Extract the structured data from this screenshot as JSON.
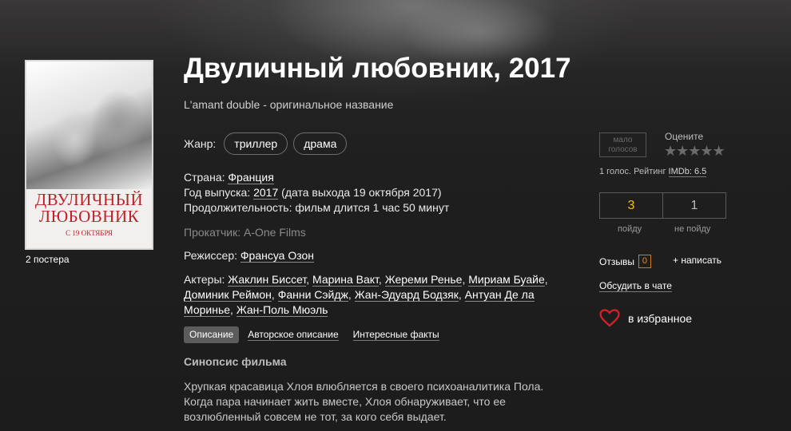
{
  "movie": {
    "title": "Двуличный любовник, 2017",
    "original_title": "L'amant double - оригинальное название"
  },
  "poster": {
    "title_line1": "ДВУЛИЧНЫЙ",
    "title_line2": "ЛЮБОВНИК",
    "date_text": "С 19 ОКТЯБРЯ",
    "count_label": "2 постера"
  },
  "genre": {
    "label": "Жанр:",
    "items": [
      "триллер",
      "драма"
    ]
  },
  "country": {
    "label": "Страна:",
    "value": "Франция"
  },
  "year": {
    "label": "Год выпуска:",
    "value": "2017",
    "note": "(дата выхода 19 октября 2017)"
  },
  "duration": {
    "label": "Продолжительность:",
    "value": "фильм длится 1 час 50 минут"
  },
  "distributor": {
    "text": "Прокатчик: A-One Films"
  },
  "director": {
    "label": "Режиссер:",
    "value": "Франсуа Озон"
  },
  "actors": {
    "label": "Актеры:",
    "list": [
      "Жаклин Биссет",
      "Марина Вакт",
      "Жереми Ренье",
      "Мириам Буайе",
      "Доминик Реймон",
      "Фанни Сэйдж",
      "Жан-Эдуард Бодзяк",
      "Антуан Де ла Моринье",
      "Жан-Поль Мюэль"
    ]
  },
  "tabs": [
    "Описание",
    "Авторское описание",
    "Интересные факты"
  ],
  "synopsis": {
    "title": "Синопсис фильма",
    "text": "Хрупкая красавица Хлоя влюбляется в своего психоаналитика Пола. Когда пара начинает жить вместе, Хлоя обнаруживает, что ее возлюбленный совсем не тот, за кого себя выдает."
  },
  "rating": {
    "few_votes_line1": "мало",
    "few_votes_line2": "голосов",
    "rate_label": "Оцените",
    "stars": "★★★★★",
    "votes_text": "1 голос. Рейтинг ",
    "imdb_text": "IMDb: 6.5",
    "up_count": "3",
    "down_count": "1",
    "up_label": "пойду",
    "down_label": "не пойду",
    "up_color": "#f2c200"
  },
  "actions": {
    "reviews_label": "Отзывы",
    "reviews_count": "0",
    "write_label": "+ написать",
    "chat_label": "Обсудить в чате",
    "favorite_label": "в избранное",
    "heart_color": "#d8202a"
  }
}
